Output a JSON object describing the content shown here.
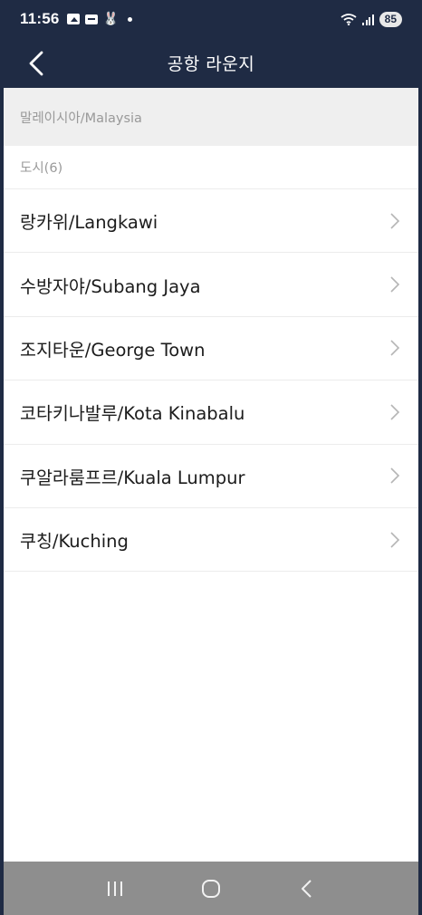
{
  "status_bar": {
    "time": "11:56",
    "battery": "85",
    "left_icons": [
      "photo-icon",
      "message-icon",
      "bunny-icon",
      "dot-icon"
    ],
    "right_icons": [
      "wifi-icon",
      "signal-icon",
      "battery-icon"
    ]
  },
  "header": {
    "title": "공항 라운지",
    "back_icon": "chevron-left-icon"
  },
  "country": {
    "label": "말레이시아/Malaysia"
  },
  "cities": {
    "section_label": "도시(6)",
    "items": [
      {
        "label": "랑카위/Langkawi"
      },
      {
        "label": "수방자야/Subang Jaya"
      },
      {
        "label": "조지타운/George Town"
      },
      {
        "label": "코타키나발루/Kota Kinabalu"
      },
      {
        "label": "쿠알라룸프르/Kuala Lumpur"
      },
      {
        "label": "쿠칭/Kuching"
      }
    ]
  },
  "nav_bar": {
    "buttons": [
      "recent-apps-icon",
      "home-icon",
      "back-icon"
    ]
  },
  "colors": {
    "header_bg": "#1f2b44",
    "country_band_bg": "#efefef",
    "divider": "#ececec",
    "nav_bar_bg": "#8e8e8e"
  }
}
